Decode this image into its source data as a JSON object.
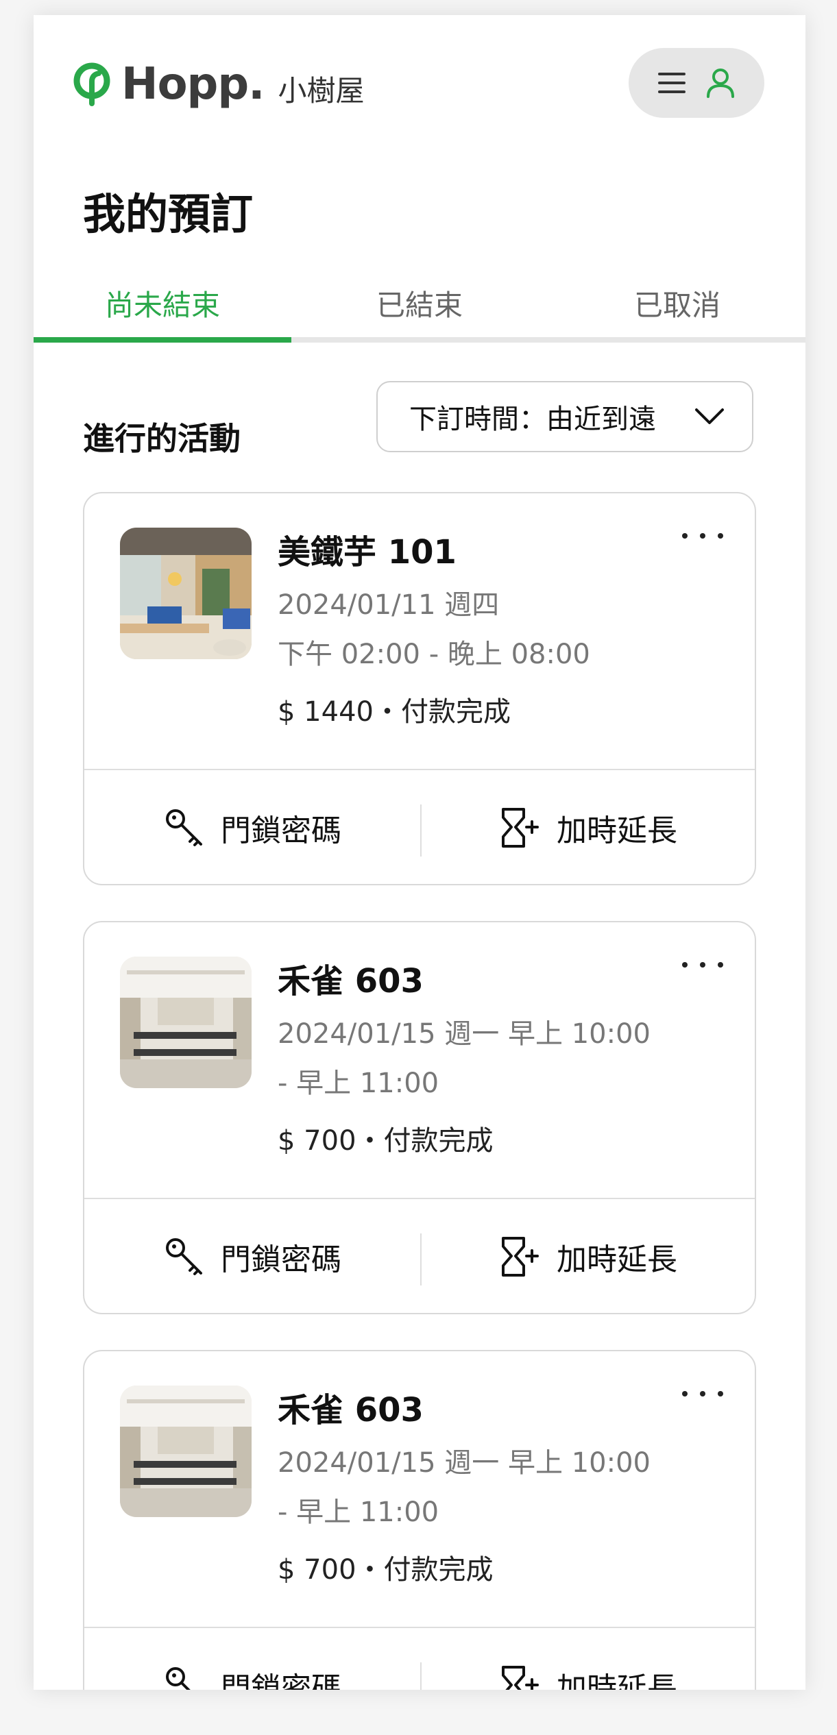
{
  "header": {
    "brand": "Hopp.",
    "brand_sub": "小樹屋",
    "brand_color": "#2aa84a"
  },
  "page_title": "我的預訂",
  "tabs": [
    {
      "label": "尚未結束",
      "active": true
    },
    {
      "label": "已結束",
      "active": false
    },
    {
      "label": "已取消",
      "active": false
    }
  ],
  "section_title": "進行的活動",
  "sort": {
    "label": "下訂時間：由近到遠"
  },
  "bookings": [
    {
      "title": "美鐵芋 101",
      "line1": "2024/01/11 週四",
      "line2": "下午 02:00 - 晚上 08:00",
      "price": "$ 1440・付款完成",
      "lock_label": "門鎖密碼",
      "extend_label": "加時延長"
    },
    {
      "title": "禾雀 603",
      "line1": "2024/01/15 週一 早上 10:00",
      "line2": "- 早上 11:00",
      "price": "$ 700・付款完成",
      "lock_label": "門鎖密碼",
      "extend_label": "加時延長"
    },
    {
      "title": "禾雀 603",
      "line1": "2024/01/15 週一 早上 10:00",
      "line2": "- 早上 11:00",
      "price": "$ 700・付款完成",
      "lock_label": "門鎖密碼",
      "extend_label": "加時延長"
    }
  ]
}
